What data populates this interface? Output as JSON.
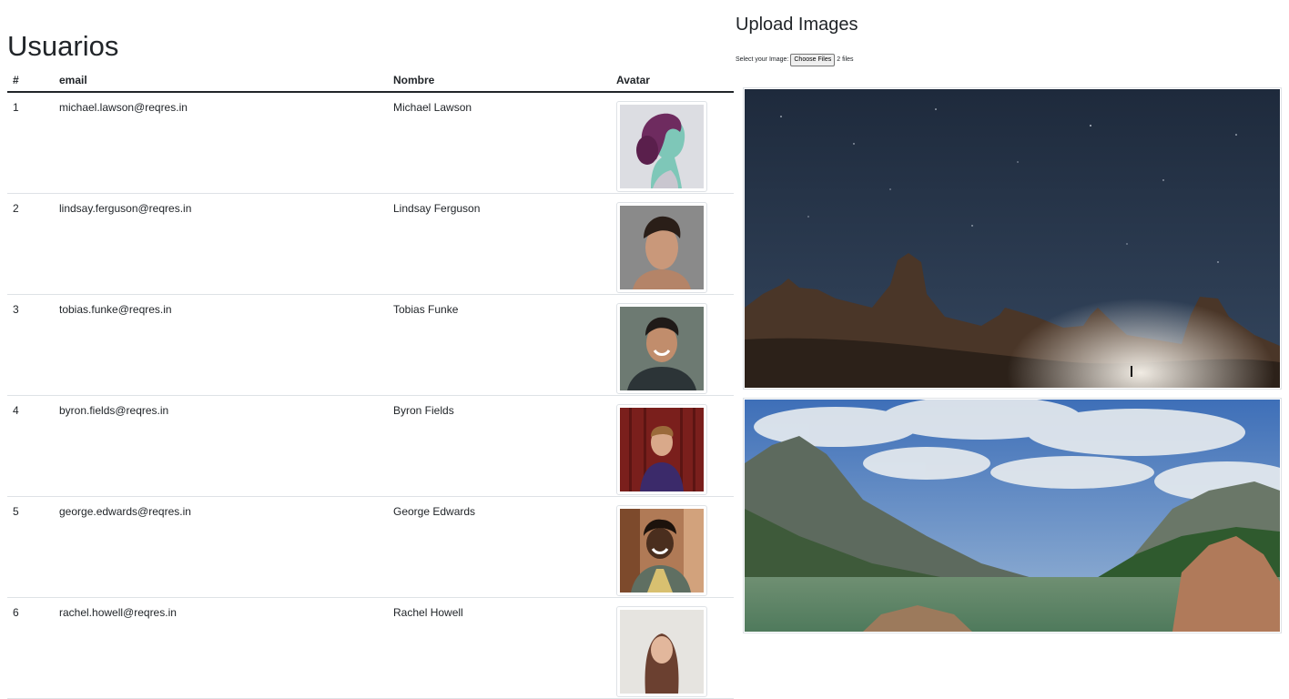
{
  "users": {
    "title": "Usuarios",
    "columns": [
      "#",
      "email",
      "Nombre",
      "Avatar"
    ],
    "rows": [
      {
        "id": "1",
        "email": "michael.lawson@reqres.in",
        "name": "Michael Lawson",
        "avatar": "avatar-michael-lawson"
      },
      {
        "id": "2",
        "email": "lindsay.ferguson@reqres.in",
        "name": "Lindsay Ferguson",
        "avatar": "avatar-lindsay-ferguson"
      },
      {
        "id": "3",
        "email": "tobias.funke@reqres.in",
        "name": "Tobias Funke",
        "avatar": "avatar-tobias-funke"
      },
      {
        "id": "4",
        "email": "byron.fields@reqres.in",
        "name": "Byron Fields",
        "avatar": "avatar-byron-fields"
      },
      {
        "id": "5",
        "email": "george.edwards@reqres.in",
        "name": "George Edwards",
        "avatar": "avatar-george-edwards"
      },
      {
        "id": "6",
        "email": "rachel.howell@reqres.in",
        "name": "Rachel Howell",
        "avatar": "avatar-rachel-howell"
      }
    ]
  },
  "upload": {
    "title": "Upload Images",
    "label": "Select your Image:",
    "button_label": "Choose Files",
    "status": "2 files",
    "images": [
      "night-desert-photo",
      "mountain-lake-photo"
    ]
  }
}
